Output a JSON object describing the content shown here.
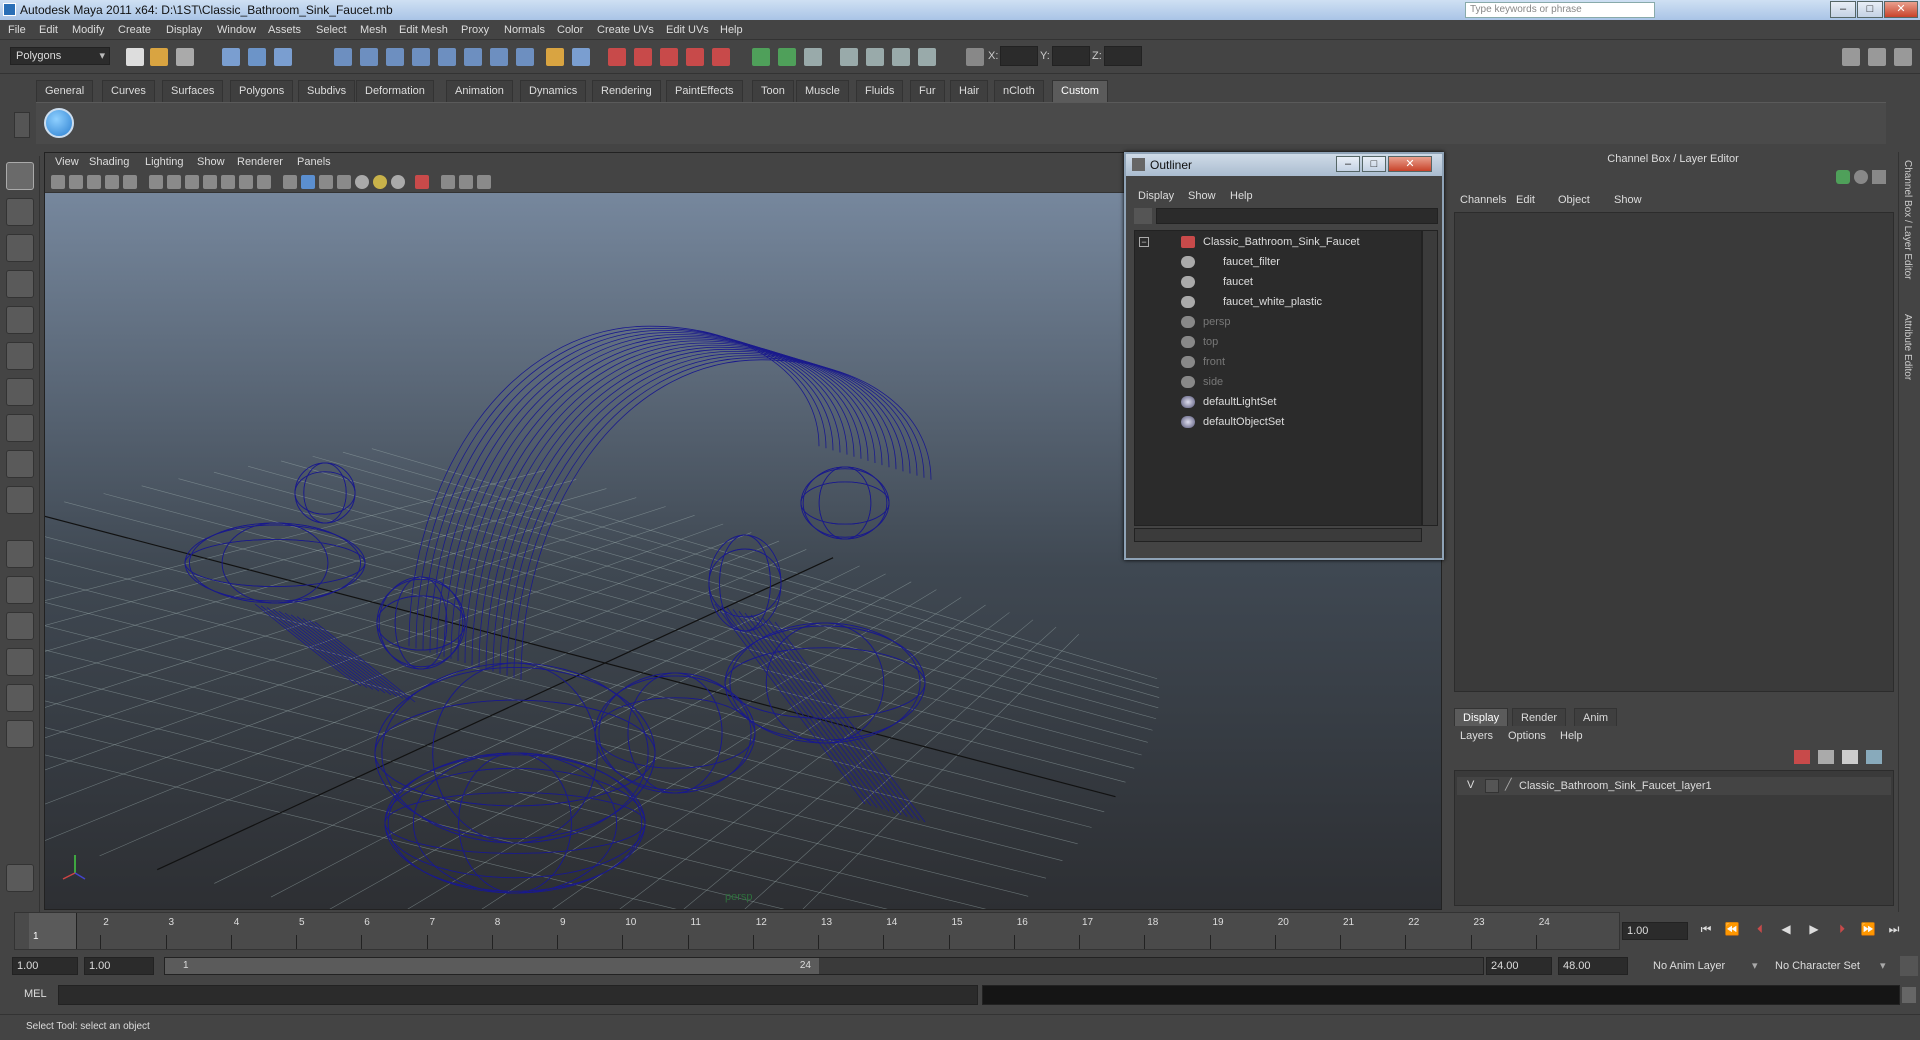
{
  "window": {
    "title": "Autodesk Maya 2011 x64: D:\\1ST\\Classic_Bathroom_Sink_Faucet.mb",
    "search_placeholder": "Type keywords or phrase"
  },
  "menubar": [
    "File",
    "Edit",
    "Modify",
    "Create",
    "Display",
    "Window",
    "Assets",
    "Select",
    "Mesh",
    "Edit Mesh",
    "Proxy",
    "Normals",
    "Color",
    "Create UVs",
    "Edit UVs",
    "Help"
  ],
  "toolbar": {
    "mode": "Polygons",
    "x_label": "X:",
    "y_label": "Y:",
    "z_label": "Z:"
  },
  "shelf_tabs": [
    "General",
    "Curves",
    "Surfaces",
    "Polygons",
    "Subdivs",
    "Deformation",
    "Animation",
    "Dynamics",
    "Rendering",
    "PaintEffects",
    "Toon",
    "Muscle",
    "Fluids",
    "Fur",
    "Hair",
    "nCloth",
    "Custom"
  ],
  "shelf_active": "Custom",
  "viewport": {
    "menu": [
      "View",
      "Shading",
      "Lighting",
      "Show",
      "Renderer",
      "Panels"
    ],
    "camera_label": "persp",
    "wireframe_color": "#1a1a8c"
  },
  "outliner": {
    "title": "Outliner",
    "menu": [
      "Display",
      "Show",
      "Help"
    ],
    "items": [
      {
        "label": "Classic_Bathroom_Sink_Faucet",
        "dim": false
      },
      {
        "label": "faucet_filter",
        "dim": false
      },
      {
        "label": "faucet",
        "dim": false
      },
      {
        "label": "faucet_white_plastic",
        "dim": false
      },
      {
        "label": "persp",
        "dim": true
      },
      {
        "label": "top",
        "dim": true
      },
      {
        "label": "front",
        "dim": true
      },
      {
        "label": "side",
        "dim": true
      },
      {
        "label": "defaultLightSet",
        "dim": false
      },
      {
        "label": "defaultObjectSet",
        "dim": false
      }
    ]
  },
  "channel_box": {
    "title": "Channel Box / Layer Editor",
    "menu": [
      "Channels",
      "Edit",
      "Object",
      "Show"
    ]
  },
  "layer_editor": {
    "tabs": [
      "Display",
      "Render",
      "Anim"
    ],
    "active_tab": "Display",
    "menu": [
      "Layers",
      "Options",
      "Help"
    ],
    "layer": {
      "visible": "V",
      "name": "Classic_Bathroom_Sink_Faucet_layer1"
    }
  },
  "side_tabs": [
    "Channel Box / Layer Editor",
    "Attribute Editor"
  ],
  "timeline": {
    "ticks": [
      "1",
      "2",
      "3",
      "4",
      "5",
      "6",
      "7",
      "8",
      "9",
      "10",
      "11",
      "12",
      "13",
      "14",
      "15",
      "16",
      "17",
      "18",
      "19",
      "20",
      "21",
      "22",
      "23",
      "24"
    ],
    "current_frame_marker": "1",
    "current_frame": "1.00"
  },
  "range": {
    "start": "1.00",
    "playback_start": "1.00",
    "range_start_label": "1",
    "range_end_label": "24",
    "playback_end": "24.00",
    "end": "48.00",
    "anim_layer": "No Anim Layer",
    "character_set": "No Character Set"
  },
  "command": {
    "label": "MEL"
  },
  "help_line": "Select Tool: select an object"
}
